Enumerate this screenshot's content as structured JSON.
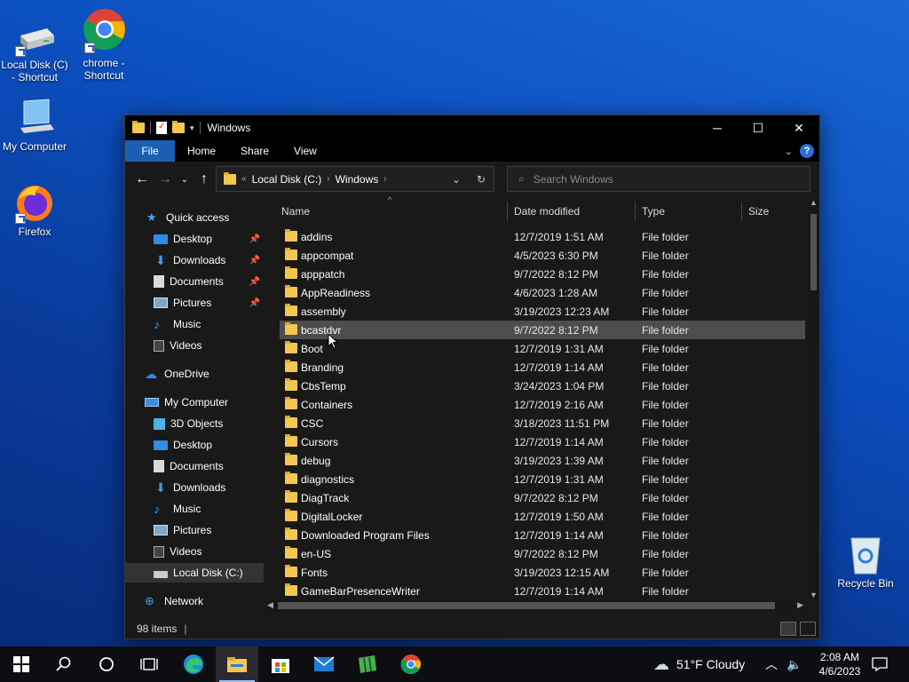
{
  "desktop": {
    "icons": [
      {
        "label": "Local Disk (C) - Shortcut",
        "icon": "drive-icon"
      },
      {
        "label": "chrome - Shortcut",
        "icon": "chrome-icon"
      },
      {
        "label": "My Computer",
        "icon": "computer-icon"
      },
      {
        "label": "Firefox",
        "icon": "firefox-icon"
      },
      {
        "label": "Recycle Bin",
        "icon": "recycle-bin-icon"
      }
    ]
  },
  "window": {
    "title": "Windows",
    "ribbon_tabs": [
      "File",
      "Home",
      "Share",
      "View"
    ],
    "help": "?",
    "address": {
      "overflow": "«",
      "crumbs": [
        "Local Disk (C:)",
        "Windows"
      ]
    },
    "search": {
      "placeholder": "Search Windows"
    },
    "columns": [
      "Name",
      "Date modified",
      "Type",
      "Size"
    ],
    "status": {
      "items": "98 items"
    }
  },
  "sidebar": {
    "items": [
      {
        "label": "Quick access",
        "icon": "star-icon",
        "pinned": false
      },
      {
        "label": "Desktop",
        "icon": "desktop-icon",
        "pinned": true
      },
      {
        "label": "Downloads",
        "icon": "download-icon",
        "pinned": true
      },
      {
        "label": "Documents",
        "icon": "documents-icon",
        "pinned": true
      },
      {
        "label": "Pictures",
        "icon": "pictures-icon",
        "pinned": true
      },
      {
        "label": "Music",
        "icon": "music-icon",
        "pinned": false
      },
      {
        "label": "Videos",
        "icon": "videos-icon",
        "pinned": false
      },
      {
        "label": "OneDrive",
        "icon": "cloud-icon",
        "pinned": false
      },
      {
        "label": "My Computer",
        "icon": "computer-icon",
        "pinned": false
      },
      {
        "label": "3D Objects",
        "icon": "3d-objects-icon",
        "pinned": false
      },
      {
        "label": "Desktop",
        "icon": "desktop-icon",
        "pinned": false
      },
      {
        "label": "Documents",
        "icon": "documents-icon",
        "pinned": false
      },
      {
        "label": "Downloads",
        "icon": "download-icon",
        "pinned": false
      },
      {
        "label": "Music",
        "icon": "music-icon",
        "pinned": false
      },
      {
        "label": "Pictures",
        "icon": "pictures-icon",
        "pinned": false
      },
      {
        "label": "Videos",
        "icon": "videos-icon",
        "pinned": false
      },
      {
        "label": "Local Disk (C:)",
        "icon": "drive-icon",
        "pinned": false,
        "selected": true
      },
      {
        "label": "Network",
        "icon": "network-icon",
        "pinned": false
      }
    ]
  },
  "files": [
    {
      "name": "addins",
      "date": "12/7/2019 1:51 AM",
      "type": "File folder"
    },
    {
      "name": "appcompat",
      "date": "4/5/2023 6:30 PM",
      "type": "File folder"
    },
    {
      "name": "apppatch",
      "date": "9/7/2022 8:12 PM",
      "type": "File folder"
    },
    {
      "name": "AppReadiness",
      "date": "4/6/2023 1:28 AM",
      "type": "File folder"
    },
    {
      "name": "assembly",
      "date": "3/19/2023 12:23 AM",
      "type": "File folder"
    },
    {
      "name": "bcastdvr",
      "date": "9/7/2022 8:12 PM",
      "type": "File folder",
      "hover": true
    },
    {
      "name": "Boot",
      "date": "12/7/2019 1:31 AM",
      "type": "File folder"
    },
    {
      "name": "Branding",
      "date": "12/7/2019 1:14 AM",
      "type": "File folder"
    },
    {
      "name": "CbsTemp",
      "date": "3/24/2023 1:04 PM",
      "type": "File folder"
    },
    {
      "name": "Containers",
      "date": "12/7/2019 2:16 AM",
      "type": "File folder"
    },
    {
      "name": "CSC",
      "date": "3/18/2023 11:51 PM",
      "type": "File folder"
    },
    {
      "name": "Cursors",
      "date": "12/7/2019 1:14 AM",
      "type": "File folder"
    },
    {
      "name": "debug",
      "date": "3/19/2023 1:39 AM",
      "type": "File folder"
    },
    {
      "name": "diagnostics",
      "date": "12/7/2019 1:31 AM",
      "type": "File folder"
    },
    {
      "name": "DiagTrack",
      "date": "9/7/2022 8:12 PM",
      "type": "File folder"
    },
    {
      "name": "DigitalLocker",
      "date": "12/7/2019 1:50 AM",
      "type": "File folder"
    },
    {
      "name": "Downloaded Program Files",
      "date": "12/7/2019 1:14 AM",
      "type": "File folder"
    },
    {
      "name": "en-US",
      "date": "9/7/2022 8:12 PM",
      "type": "File folder"
    },
    {
      "name": "Fonts",
      "date": "3/19/2023 12:15 AM",
      "type": "File folder"
    },
    {
      "name": "GameBarPresenceWriter",
      "date": "12/7/2019 1:14 AM",
      "type": "File folder"
    }
  ],
  "taskbar": {
    "weather": "51°F  Cloudy",
    "time": "2:08 AM",
    "date": "4/6/2023"
  }
}
